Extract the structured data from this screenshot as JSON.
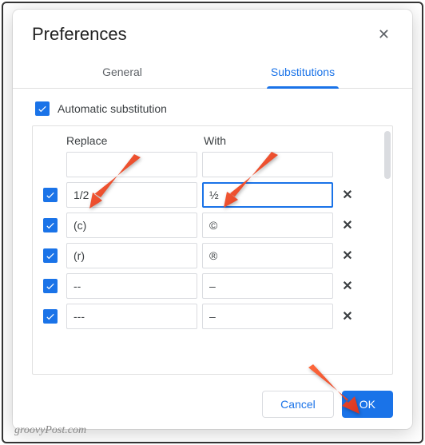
{
  "dialog": {
    "title": "Preferences",
    "tabs": {
      "general": "General",
      "substitutions": "Substitutions"
    },
    "autoSubLabel": "Automatic substitution",
    "headers": {
      "replace": "Replace",
      "with": "With"
    },
    "rows": [
      {
        "enabled": false,
        "replace": "",
        "with": "",
        "removable": false
      },
      {
        "enabled": true,
        "replace": "1/2",
        "with": "½",
        "removable": true,
        "focused": true
      },
      {
        "enabled": true,
        "replace": "(c)",
        "with": "©",
        "removable": true
      },
      {
        "enabled": true,
        "replace": "(r)",
        "with": "®",
        "removable": true
      },
      {
        "enabled": true,
        "replace": "--",
        "with": "–",
        "removable": true
      },
      {
        "enabled": true,
        "replace": "---",
        "with": "–",
        "removable": true
      }
    ],
    "buttons": {
      "cancel": "Cancel",
      "ok": "OK"
    }
  },
  "watermark": "groovyPost.com"
}
